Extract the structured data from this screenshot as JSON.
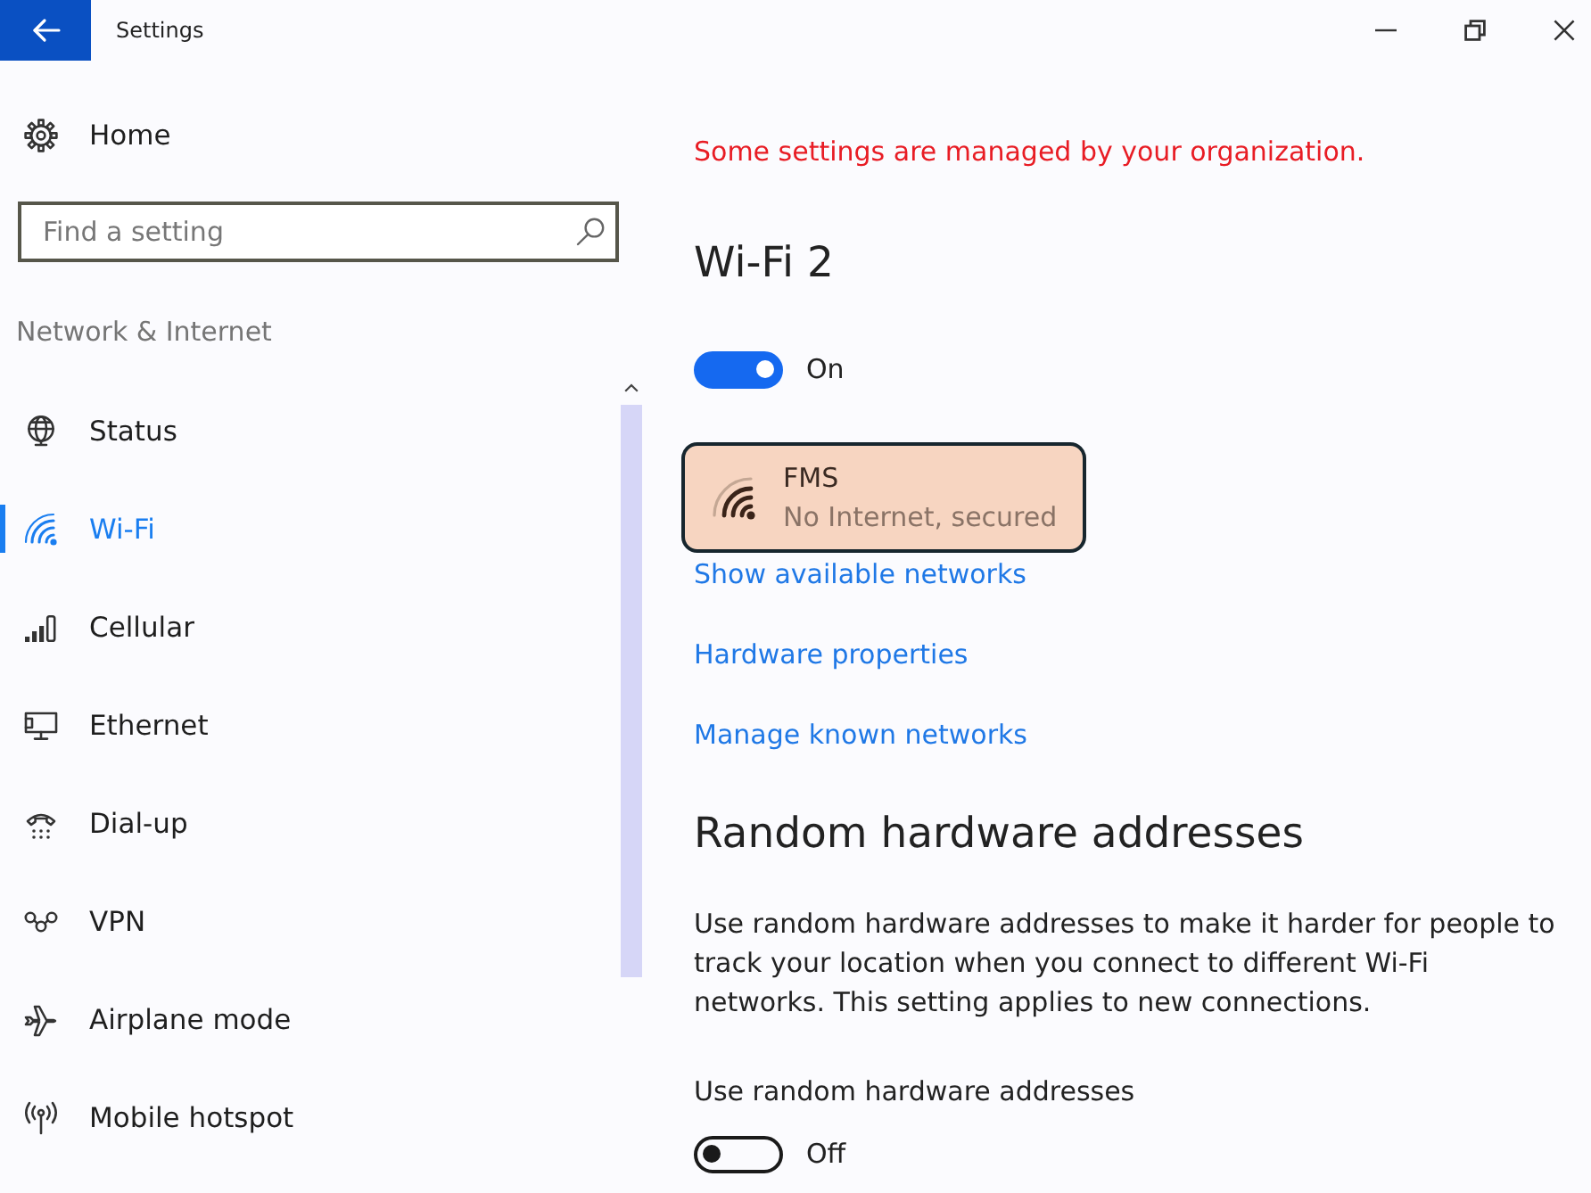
{
  "window": {
    "title": "Settings"
  },
  "sidebar": {
    "home": {
      "label": "Home"
    },
    "search": {
      "placeholder": "Find a setting"
    },
    "section_title": "Network & Internet",
    "items": [
      {
        "kind": "status",
        "label": "Status",
        "selected": false
      },
      {
        "kind": "wifi",
        "label": "Wi-Fi",
        "selected": true
      },
      {
        "kind": "cellular",
        "label": "Cellular",
        "selected": false
      },
      {
        "kind": "ethernet",
        "label": "Ethernet",
        "selected": false
      },
      {
        "kind": "dialup",
        "label": "Dial-up",
        "selected": false
      },
      {
        "kind": "vpn",
        "label": "VPN",
        "selected": false
      },
      {
        "kind": "airplane",
        "label": "Airplane mode",
        "selected": false
      },
      {
        "kind": "hotspot",
        "label": "Mobile hotspot",
        "selected": false
      }
    ]
  },
  "content": {
    "notice": "Some settings are managed by your organization.",
    "title": "Wi-Fi 2",
    "wifi_toggle": {
      "on": true,
      "label": "On"
    },
    "network": {
      "name": "FMS",
      "status": "No Internet, secured"
    },
    "links": [
      "Show available networks",
      "Hardware properties",
      "Manage known networks"
    ],
    "random_addresses": {
      "heading": "Random hardware addresses",
      "description": "Use random hardware addresses to make it harder for people to track your location when you connect to different Wi-Fi networks. This setting applies to new connections.",
      "setting_label": "Use random hardware addresses",
      "toggle": {
        "on": false,
        "label": "Off"
      }
    }
  }
}
